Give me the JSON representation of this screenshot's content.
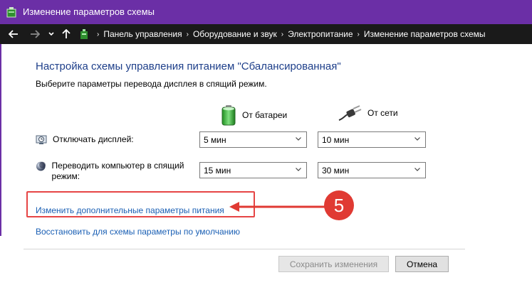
{
  "window": {
    "title": "Изменение параметров схемы",
    "accent_color": "#6b2fa6"
  },
  "nav": {
    "back_icon": "arrow-left-icon",
    "forward_icon": "arrow-right-icon",
    "recent_icon": "chevron-down-icon",
    "up_icon": "arrow-up-icon",
    "breadcrumbs": [
      "Панель управления",
      "Оборудование и звук",
      "Электропитание",
      "Изменение параметров схемы"
    ]
  },
  "main": {
    "heading": "Настройка схемы управления питанием \"Сбалансированная\"",
    "subtitle": "Выберите параметры перевода дисплея в спящий режим.",
    "columns": {
      "battery": "От батареи",
      "plugged": "От сети"
    },
    "rows": [
      {
        "label": "Отключать дисплей:",
        "icon": "display-icon",
        "battery_value": "5 мин",
        "plugged_value": "10 мин"
      },
      {
        "label": "Переводить компьютер в спящий режим:",
        "icon": "moon-icon",
        "battery_value": "15 мин",
        "plugged_value": "30 мин"
      }
    ],
    "links": {
      "advanced": "Изменить дополнительные параметры питания",
      "restore": "Восстановить для схемы параметры по умолчанию"
    },
    "annotation": {
      "step_number": "5",
      "color": "#e03a33"
    },
    "buttons": {
      "save": "Сохранить изменения",
      "cancel": "Отмена"
    }
  }
}
